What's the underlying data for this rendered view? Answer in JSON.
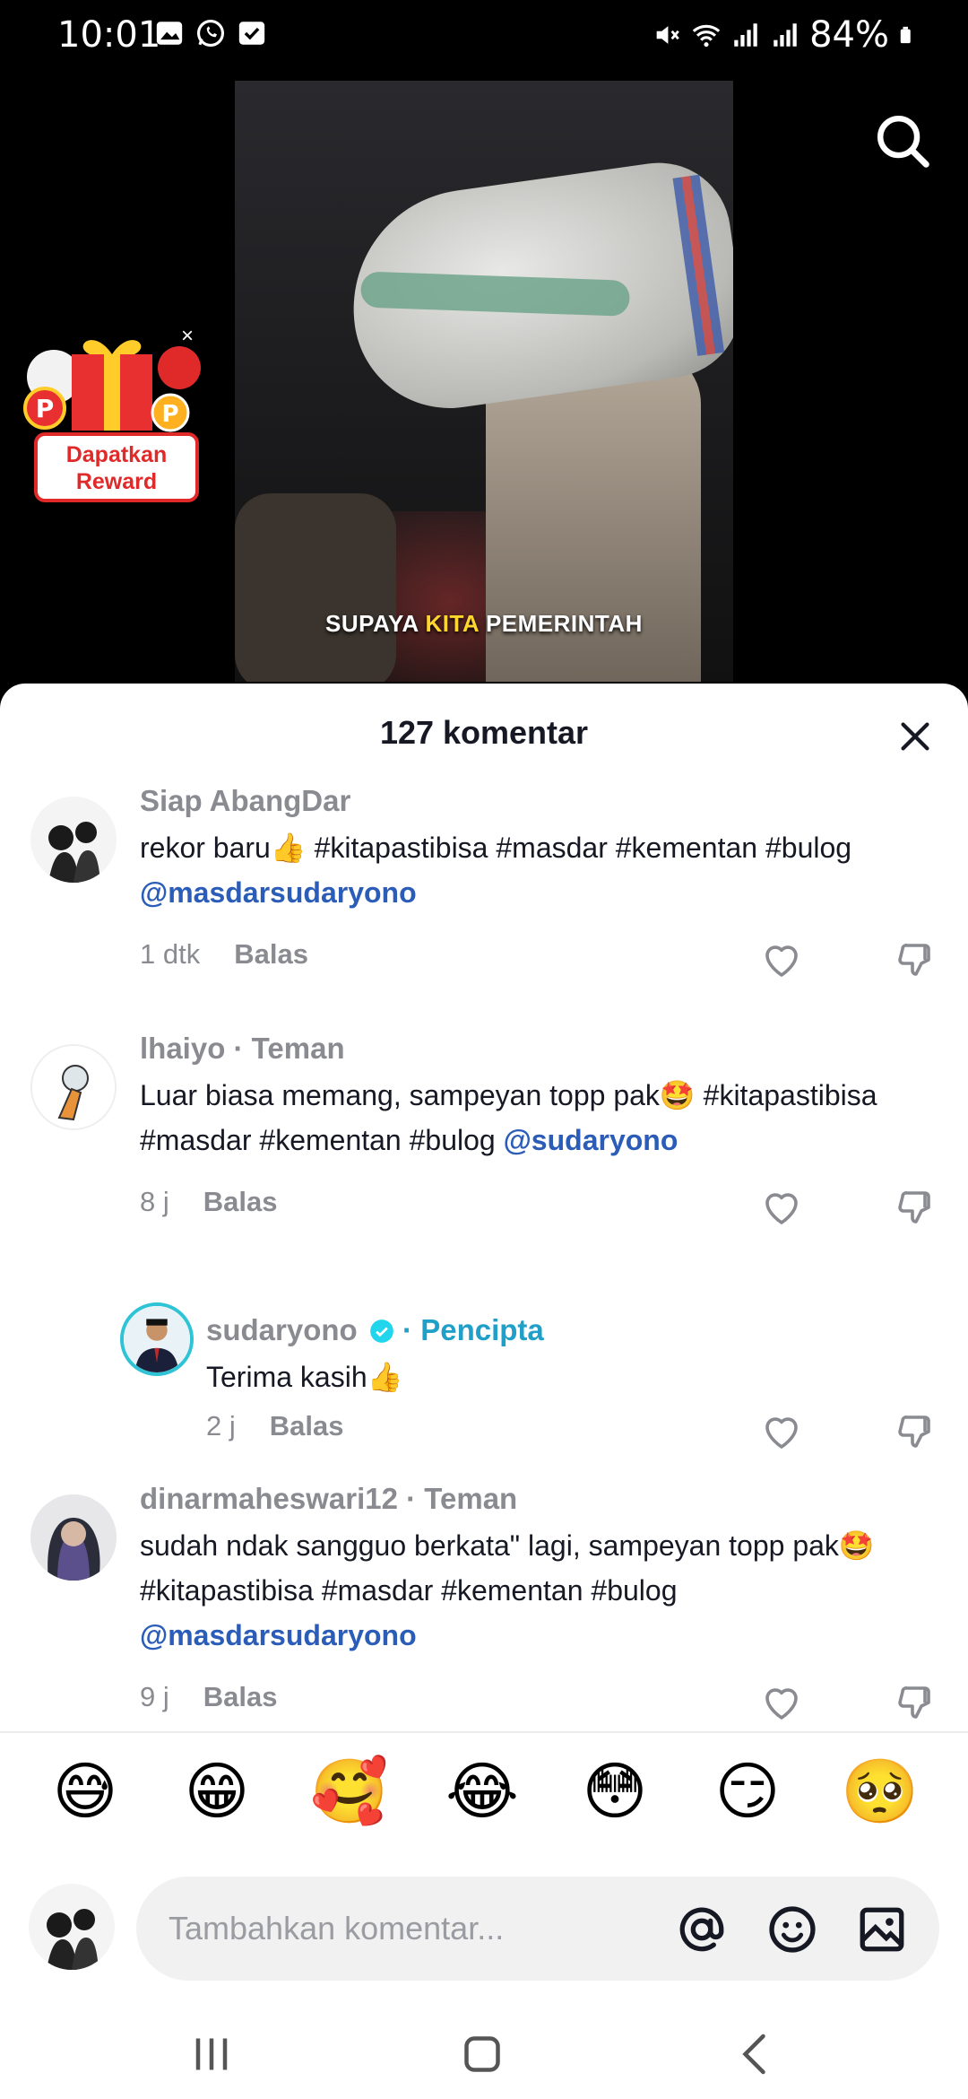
{
  "status": {
    "time": "10:01",
    "battery": "84%"
  },
  "video": {
    "caption_pre": "SUPAYA ",
    "caption_highlight": "KITA",
    "caption_post": " PEMERINTAH"
  },
  "reward": {
    "label_line1": "Dapatkan",
    "label_line2": "Reward",
    "close": "×"
  },
  "sheet": {
    "title": "127 komentar"
  },
  "comments": [
    {
      "user": "Siap AbangDar",
      "text_line1": "rekor baru👍 #kitapastibisa #masdar #kementan #bulog",
      "mention": "@masdarsudaryono",
      "time": "1 dtk",
      "reply": "Balas"
    },
    {
      "user": "lhaiyo · Teman",
      "text_line1": "Luar biasa memang, sampeyan topp pak🤩 #kitapastibisa",
      "text_line2": "#masdar #kementan #bulog ",
      "mention": "@sudaryono",
      "time": "8 j",
      "reply": "Balas"
    },
    {
      "user": "sudaryono",
      "badge": "· Pencipta",
      "text": "Terima kasih👍",
      "time": "2 j",
      "reply": "Balas"
    },
    {
      "user": "dinarmaheswari12 · Teman",
      "text_line1": "sudah ndak sangguo berkata\" lagi, sampeyan topp pak🤩",
      "text_line2": "#kitapastibisa #masdar #kementan #bulog",
      "mention": "@masdarsudaryono",
      "time": "9 j",
      "reply": "Balas"
    }
  ],
  "emojis": [
    "😅",
    "😁",
    "🥰",
    "😂",
    "😳",
    "😏",
    "🥺"
  ],
  "input": {
    "placeholder": "Tambahkan komentar..."
  },
  "colors": {
    "mention": "#2b5db8",
    "creator": "#20a0c8",
    "reward_red": "#e02a2a"
  }
}
